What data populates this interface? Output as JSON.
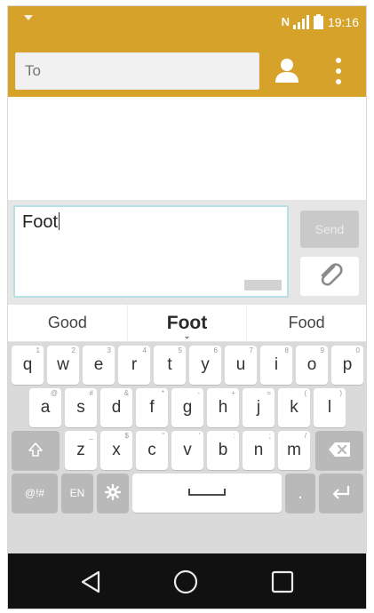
{
  "status_bar": {
    "time": "19:16",
    "nfc_label": "N",
    "icons": [
      "notification-icon",
      "nfc-icon",
      "signal-icon",
      "battery-icon"
    ]
  },
  "app_bar": {
    "to_placeholder": "To",
    "actions": [
      "contact-icon",
      "more-vertical-icon"
    ]
  },
  "composer": {
    "message_text": "Foot",
    "send_label": "Send",
    "attach_icon": "paperclip-icon"
  },
  "suggestions": [
    "Good",
    "Foot",
    "Food"
  ],
  "keyboard": {
    "row1": [
      {
        "key": "q",
        "hint": "1"
      },
      {
        "key": "w",
        "hint": "2"
      },
      {
        "key": "e",
        "hint": "3"
      },
      {
        "key": "r",
        "hint": "4"
      },
      {
        "key": "t",
        "hint": "5"
      },
      {
        "key": "y",
        "hint": "6"
      },
      {
        "key": "u",
        "hint": "7"
      },
      {
        "key": "i",
        "hint": "8"
      },
      {
        "key": "o",
        "hint": "9"
      },
      {
        "key": "p",
        "hint": "0"
      }
    ],
    "row2": [
      {
        "key": "a",
        "hint": "@"
      },
      {
        "key": "s",
        "hint": "#"
      },
      {
        "key": "d",
        "hint": "&"
      },
      {
        "key": "f",
        "hint": "*"
      },
      {
        "key": "g",
        "hint": "-"
      },
      {
        "key": "h",
        "hint": "+"
      },
      {
        "key": "j",
        "hint": "="
      },
      {
        "key": "k",
        "hint": "("
      },
      {
        "key": "l",
        "hint": ")"
      }
    ],
    "row3": [
      {
        "key": "z",
        "hint": "_"
      },
      {
        "key": "x",
        "hint": "$"
      },
      {
        "key": "c",
        "hint": "\""
      },
      {
        "key": "v",
        "hint": "'"
      },
      {
        "key": "b",
        "hint": ":"
      },
      {
        "key": "n",
        "hint": ";"
      },
      {
        "key": "m",
        "hint": "/"
      }
    ],
    "symbols_label": "@!#",
    "language_label": "EN",
    "period_label": ".",
    "shift_icon": "shift-icon",
    "backspace_icon": "backspace-icon",
    "settings_icon": "gear-icon",
    "space_icon": "space-icon",
    "enter_icon": "enter-icon"
  },
  "nav_bar": {
    "icons": [
      "back-icon",
      "home-icon",
      "recents-icon"
    ]
  },
  "colors": {
    "accent": "#d6a22a",
    "input_border": "#b8dfe6",
    "keyboard_bg": "#dadada",
    "nav_bg": "#111111"
  }
}
